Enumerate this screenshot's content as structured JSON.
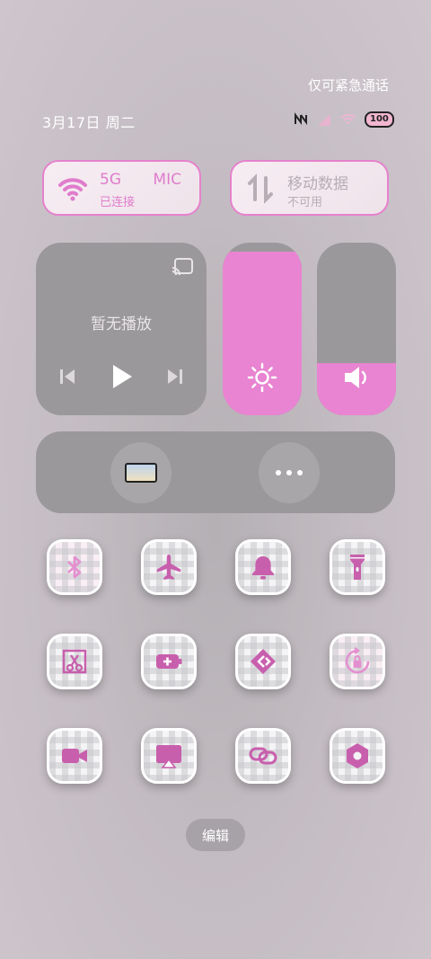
{
  "status": {
    "emergency_text": "仅可紧急通话",
    "date_text": "3月17日 周二",
    "battery": "100",
    "icons": [
      "nfc-icon",
      "signal-icon",
      "wifi-icon",
      "battery-icon"
    ]
  },
  "tiles": {
    "wifi": {
      "title": "5G",
      "title_suffix": "MIC",
      "subtitle": "已连接",
      "icon": "wifi-icon"
    },
    "mobile_data": {
      "title": "移动数据",
      "subtitle": "不可用",
      "icon": "data-arrows-icon"
    }
  },
  "media": {
    "title": "暂无播放",
    "icons": [
      "cast-icon",
      "previous-icon",
      "play-icon",
      "next-icon"
    ]
  },
  "sliders": {
    "brightness": {
      "level": 0.95,
      "icon": "sun-icon"
    },
    "volume": {
      "level": 0.3,
      "icon": "speaker-icon"
    }
  },
  "extra_bar": {
    "icons": [
      "screen-mirror-icon",
      "more-icon"
    ]
  },
  "quick_settings": [
    "bluetooth-icon",
    "airplane-icon",
    "bell-icon",
    "flashlight-icon",
    "screenshot-icon",
    "battery-saver-icon",
    "nearby-share-icon",
    "rotation-lock-icon",
    "screen-record-icon",
    "airplay-icon",
    "link-icon",
    "settings-hex-icon"
  ],
  "edit_label": "编辑",
  "colors": {
    "accent": "#e884d1",
    "panel": "#9b989b"
  }
}
